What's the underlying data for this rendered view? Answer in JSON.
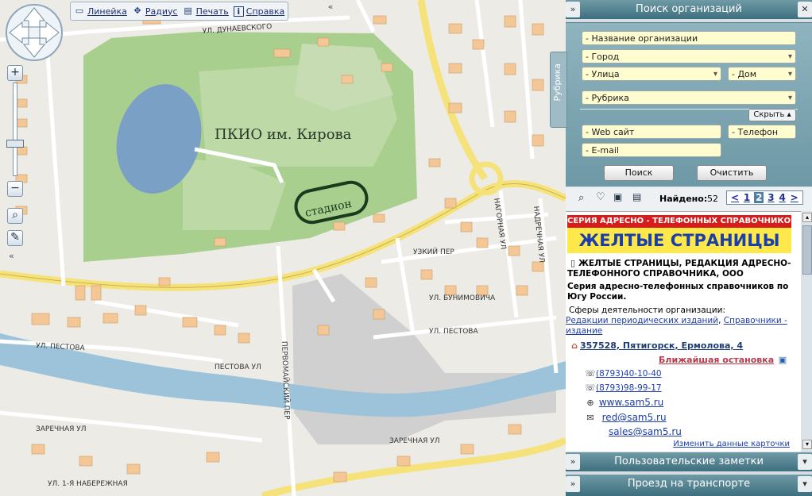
{
  "toolbar": {
    "ruler_label": "Линейка",
    "radius_label": "Радиус",
    "print_label": "Печать",
    "help_label": "Справка",
    "collapse_glyph": "«"
  },
  "map": {
    "park_label": "ПКИО им. Кирова",
    "stadium_label": "стадион",
    "streets": {
      "dunaevsky": "УЛ. ДУНАЕВСКОГО",
      "pestova_1": "УЛ. ПЕСТОВА",
      "pestova_2": "ПЕСТОВА УЛ",
      "pestova_3": "УЛ. ПЕСТОВА",
      "zarechnaya_1": "ЗАРЕЧНАЯ УЛ",
      "zarechnaya_2": "ЗАРЕЧНАЯ УЛ",
      "naberezhnaya": "УЛ. 1-Я НАБЕРЕЖНАЯ",
      "uzkiy": "УЗКИЙ ПЕР",
      "bunimovicha": "УЛ. БУНИМОВИЧА",
      "pervomaysky": "ПЕРВОМАЙСКИЙ ПЕР",
      "nagornaya": "НАГОРНАЯ УЛ",
      "nadrechnaya": "НАДРЕЧНАЯ УЛ"
    }
  },
  "panel": {
    "search_title": "Поиск организаций",
    "rubrika_tab": "Рубрика",
    "fields": {
      "org_name": "- Название организации",
      "city": "- Город",
      "street": "- Улица",
      "house": "- Дом",
      "rubric": "- Рубрика",
      "website": "- Web сайт",
      "phone": "- Телефон",
      "email": "- E-mail"
    },
    "hide_label": "Скрыть",
    "search_button": "Поиск",
    "clear_button": "Очистить",
    "found_label": "Найдено:",
    "found_count": "52",
    "pages": [
      "1",
      "2",
      "3",
      "4"
    ],
    "current_page": "2",
    "prev_glyph": "<",
    "next_glyph": ">",
    "notes_title": "Пользовательские заметки",
    "transport_title": "Проезд на транспорте"
  },
  "card": {
    "banner_top": "СЕРИЯ АДРЕСНО - ТЕЛЕФОННЫХ  СПРАВОЧНИКОВ",
    "banner_main": "ЖЕЛТЫЕ СТРАНИЦЫ",
    "org_name": "ЖЕЛТЫЕ СТРАНИЦЫ, РЕДАКЦИЯ АДРЕСНО-ТЕЛЕФОННОГО СПРАВОЧНИКА, ООО",
    "description": "Серия адресно-телефонных справочников по Югу России.",
    "activity_label": "Сферы деятельности организации:",
    "activity_link_1": "Редакции периодических изданий",
    "activity_sep": ", ",
    "activity_link_2": "Справочники - издание",
    "address": "357528, Пятигорск, Ермолова, 4",
    "nearest_stop": "Ближайшая остановка",
    "phone_1": "(8793)40-10-40",
    "phone_2": "(8793)98-99-17",
    "website": "www.sam5.ru",
    "email_1": "red@sam5.ru",
    "email_2": "sales@sam5.ru",
    "edit_link": "Изменить данные карточки"
  },
  "colors": {
    "road_yellow": "#f6e27a",
    "park_green": "#a9cf8f",
    "river_blue": "#9cc3d9",
    "building": "#f4c896",
    "panel_header": "#4f7f8d",
    "field_bg": "#fffcd0"
  }
}
